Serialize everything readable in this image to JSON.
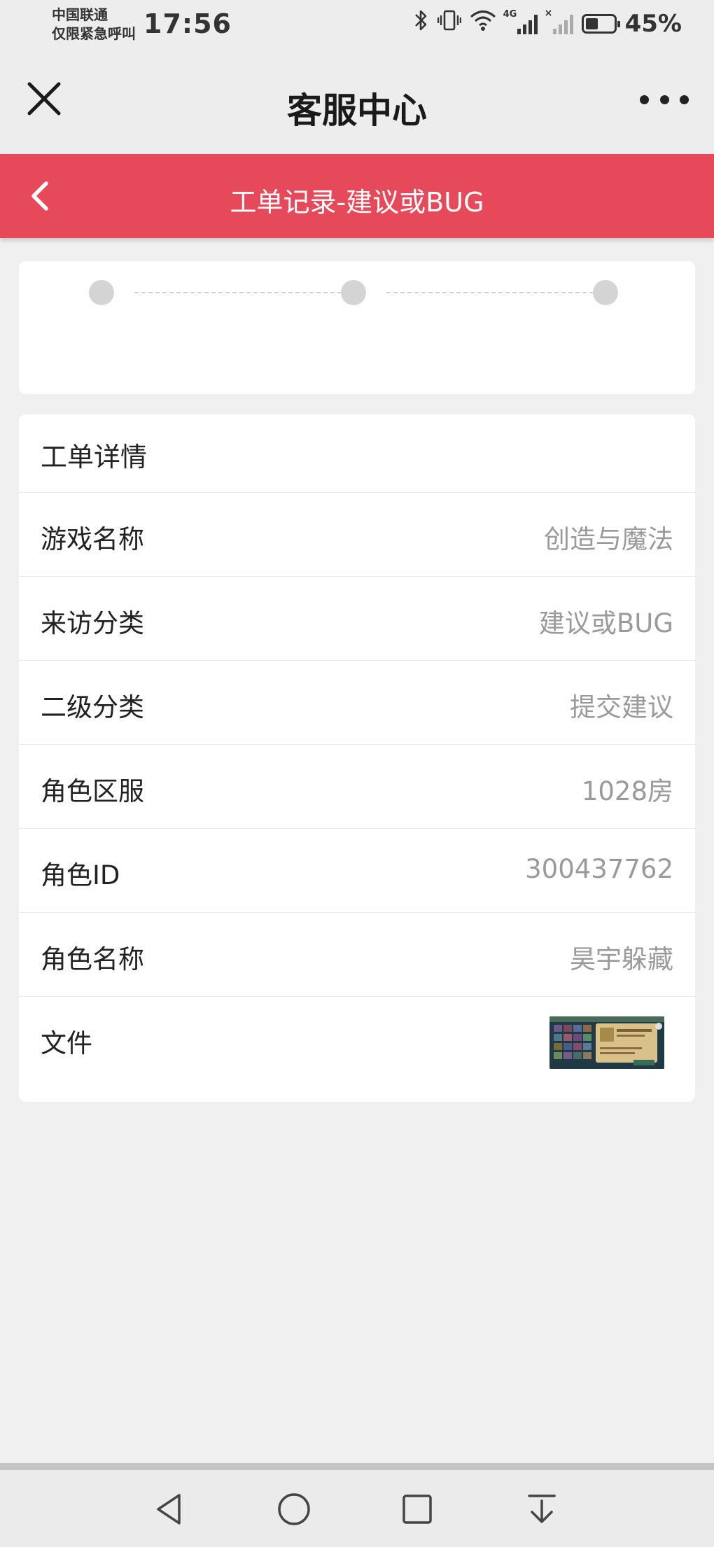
{
  "status_bar": {
    "carrier_line1": "中国联通",
    "carrier_line2": "仅限紧急呼叫",
    "time": "17:56",
    "battery_percent": "45%",
    "battery_level": 0.45,
    "icons": [
      "bluetooth-icon",
      "vibrate-icon",
      "wifi-icon",
      "signal-4g-icon",
      "signal-no-sim-icon",
      "battery-icon"
    ]
  },
  "title_bar": {
    "title": "客服中心",
    "close_icon": "close-icon",
    "more_icon": "more-icon"
  },
  "header": {
    "title": "工单记录-建议或BUG",
    "background": "#e64a5a",
    "back_icon": "chevron-left-icon"
  },
  "progress": {
    "steps": 3
  },
  "details": {
    "heading": "工单详情",
    "rows": [
      {
        "label": "游戏名称",
        "value": "创造与魔法"
      },
      {
        "label": "来访分类",
        "value": "建议或BUG"
      },
      {
        "label": "二级分类",
        "value": "提交建议"
      },
      {
        "label": "角色区服",
        "value": "1028房"
      },
      {
        "label": "角色ID",
        "value": "300437762"
      },
      {
        "label": "角色名称",
        "value": "昊宇躲藏"
      },
      {
        "label": "文件",
        "value": ""
      }
    ]
  },
  "nav_bar": {
    "buttons": [
      "back-triangle-icon",
      "home-circle-icon",
      "recents-square-icon",
      "notification-pull-icon"
    ]
  }
}
